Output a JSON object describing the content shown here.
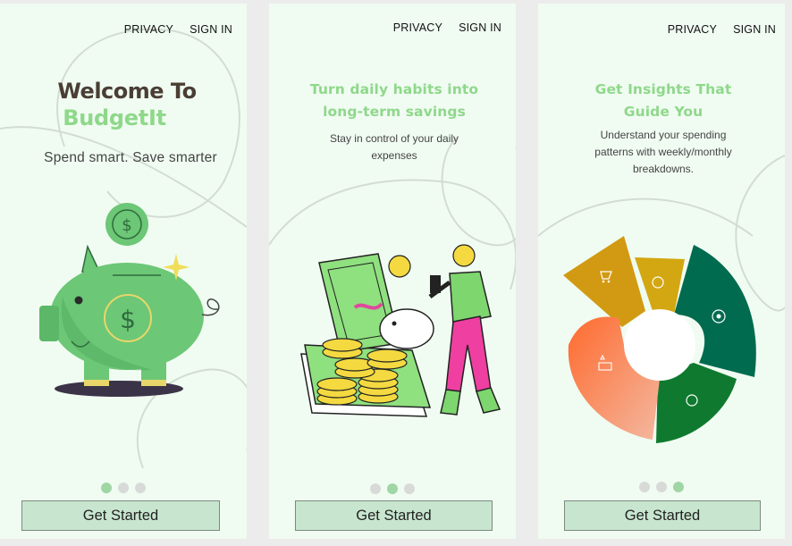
{
  "screens": [
    {
      "nav": {
        "privacy": "PRIVACY",
        "sign_in": "SIGN IN"
      },
      "title_line1": "Welcome To",
      "title_line2": "BudgetIt",
      "subtitle": "Spend smart. Save smarter",
      "illustration": "piggy-bank-with-coin",
      "pagination": {
        "total": 3,
        "active": 1
      },
      "cta": "Get Started"
    },
    {
      "nav": {
        "privacy": "PRIVACY",
        "sign_in": "SIGN IN"
      },
      "heading_line1": "Turn daily habits into",
      "heading_line2": "long-term savings",
      "body_line1": "Stay in control of your daily",
      "body_line2": "expenses",
      "illustration": "person-saving-money-into-piggy-bank",
      "pagination": {
        "total": 3,
        "active": 2
      },
      "cta": "Get Started"
    },
    {
      "nav": {
        "privacy": "PRIVACY",
        "sign_in": "SIGN IN"
      },
      "heading_line1": "Get Insights That",
      "heading_line2": "Guide You",
      "body_line1": "Understand your spending",
      "body_line2": "patterns with weekly/monthly",
      "body_line3": "breakdowns.",
      "illustration": "spending-category-donut-chart",
      "pagination": {
        "total": 3,
        "active": 3
      },
      "cta": "Get Started"
    }
  ],
  "colors": {
    "screen_bg": "#f0fcf2",
    "accent_green": "#8fd88a",
    "title_dark": "#4a3e34",
    "button_bg": "#c8e6cf",
    "dot_active": "#9fd6a4",
    "dot_inactive": "#d8dad8"
  }
}
